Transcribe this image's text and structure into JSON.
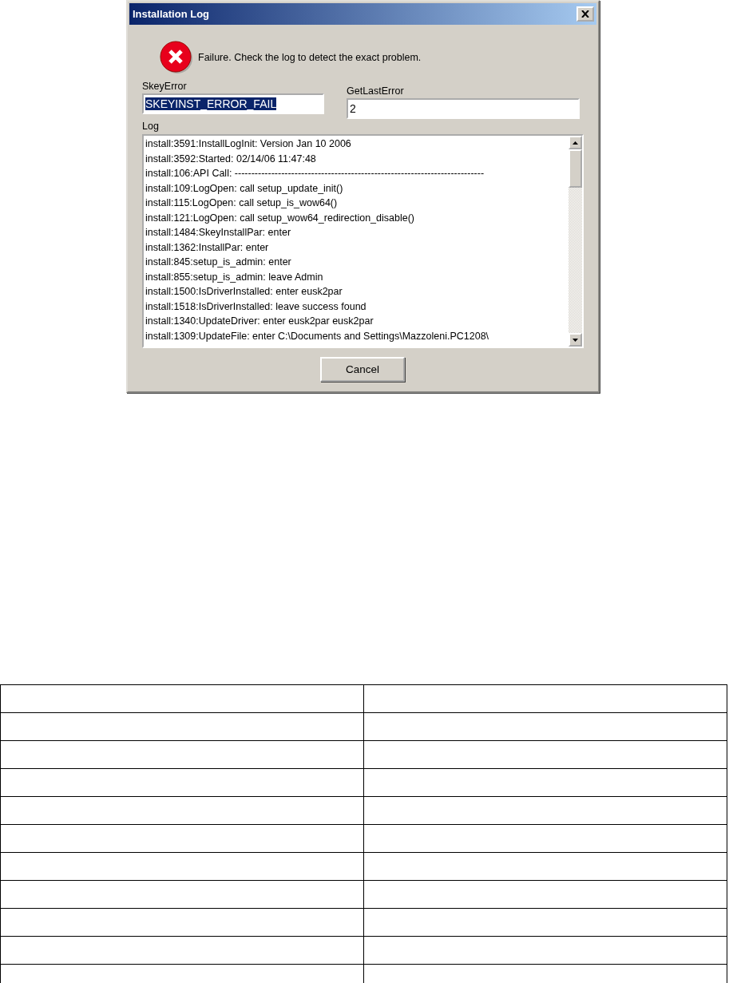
{
  "window": {
    "title": "Installation Log"
  },
  "message": "Failure. Check the log to detect the exact problem.",
  "fields": [
    {
      "label": "SkeyError",
      "value": "SKEYINST_ERROR_FAIL",
      "text_selected": true
    },
    {
      "label": "GetLastError",
      "value": "2",
      "text_selected": false
    }
  ],
  "log": {
    "label": "Log",
    "lines": [
      "install:3591:InstallLogInit: Version Jan 10 2006",
      "install:3592:Started: 02/14/06 11:47:48",
      "install:106:API Call: ---------------------------------------------------------------------------",
      "install:109:LogOpen: call setup_update_init()",
      "install:115:LogOpen: call setup_is_wow64()",
      "install:121:LogOpen: call setup_wow64_redirection_disable()",
      "install:1484:SkeyInstallPar: enter",
      "install:1362:InstallPar: enter",
      "install:845:setup_is_admin: enter",
      "install:855:setup_is_admin: leave Admin",
      "install:1500:IsDriverInstalled: enter eusk2par",
      "install:1518:IsDriverInstalled: leave success found",
      "install:1340:UpdateDriver: enter eusk2par eusk2par",
      "install:1309:UpdateFile: enter C:\\Documents and Settings\\Mazzoleni.PC1208\\"
    ]
  },
  "buttons": [
    "Cancel"
  ]
}
